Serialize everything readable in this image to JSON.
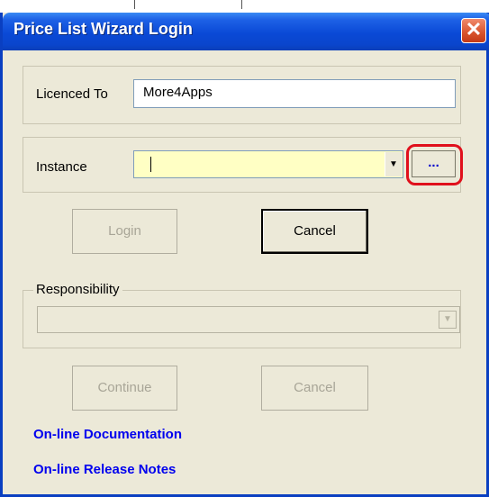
{
  "window": {
    "title": "Price List Wizard Login",
    "close_glyph": "✕"
  },
  "licence": {
    "label": "Licenced To",
    "value": "More4Apps"
  },
  "instance": {
    "label": "Instance",
    "value": "",
    "browse_label": "...",
    "dropdown_glyph": "▼"
  },
  "login_buttons": {
    "login": "Login",
    "cancel": "Cancel"
  },
  "responsibility": {
    "legend": "Responsibility",
    "value": "",
    "dropdown_glyph": "▼"
  },
  "continue_buttons": {
    "continue": "Continue",
    "cancel": "Cancel"
  },
  "links": {
    "documentation": "On-line Documentation",
    "release_notes": "On-line Release Notes"
  },
  "colors": {
    "title_bar": "#0a49d6",
    "instance_field": "#ffffc4",
    "highlight": "#e0101c",
    "link": "#0000ee"
  }
}
